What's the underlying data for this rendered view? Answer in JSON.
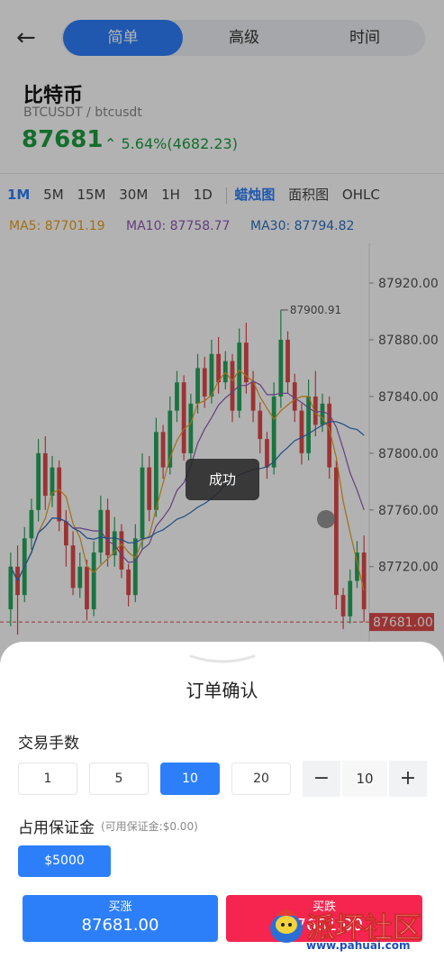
{
  "header": {
    "back_icon": "arrow-left-icon",
    "tabs": [
      {
        "label": "简单",
        "active": true
      },
      {
        "label": "高级",
        "active": false
      },
      {
        "label": "时间",
        "active": false
      }
    ]
  },
  "coin": {
    "name": "比特币",
    "pair": "BTCUSDT / btcusdt",
    "price": "87681",
    "change": "⌃ 5.64%(4682.23)"
  },
  "intervals": [
    "1M",
    "5M",
    "15M",
    "30M",
    "1H",
    "1D"
  ],
  "selected_interval": "1M",
  "chart_types": [
    "蜡烛图",
    "面积图",
    "OHLC"
  ],
  "selected_chart_type": "蜡烛图",
  "ma": {
    "ma5": "MA5: 87701.19",
    "ma10": "MA10: 87758.77",
    "ma30": "MA30: 87794.82",
    "colors": {
      "ma5": "#e8a020",
      "ma10": "#8e5bb5",
      "ma30": "#2f6fc0"
    }
  },
  "chart_data": {
    "type": "candlestick",
    "y_ticks": [
      "87920.00",
      "87880.00",
      "87840.00",
      "87800.00",
      "87760.00",
      "87720.00"
    ],
    "ylim": [
      87662,
      87948
    ],
    "high_label": "87900.91",
    "last_price_label": "87681.00",
    "colors": {
      "up": "#26a65b",
      "down": "#e04a4a"
    },
    "candles": [
      [
        87690,
        87720,
        87678,
        87730
      ],
      [
        87720,
        87700,
        87672,
        87735
      ],
      [
        87700,
        87740,
        87695,
        87748
      ],
      [
        87740,
        87760,
        87732,
        87768
      ],
      [
        87760,
        87800,
        87752,
        87810
      ],
      [
        87800,
        87770,
        87760,
        87812
      ],
      [
        87770,
        87790,
        87762,
        87798
      ],
      [
        87790,
        87752,
        87745,
        87795
      ],
      [
        87752,
        87735,
        87720,
        87760
      ],
      [
        87735,
        87705,
        87700,
        87745
      ],
      [
        87705,
        87720,
        87698,
        87730
      ],
      [
        87720,
        87690,
        87682,
        87725
      ],
      [
        87690,
        87730,
        87685,
        87738
      ],
      [
        87730,
        87760,
        87722,
        87770
      ],
      [
        87760,
        87728,
        87720,
        87768
      ],
      [
        87728,
        87745,
        87720,
        87755
      ],
      [
        87745,
        87718,
        87712,
        87750
      ],
      [
        87718,
        87700,
        87692,
        87722
      ],
      [
        87700,
        87740,
        87695,
        87750
      ],
      [
        87740,
        87790,
        87732,
        87800
      ],
      [
        87790,
        87760,
        87752,
        87798
      ],
      [
        87760,
        87815,
        87755,
        87825
      ],
      [
        87815,
        87790,
        87782,
        87820
      ],
      [
        87790,
        87830,
        87785,
        87840
      ],
      [
        87830,
        87850,
        87822,
        87858
      ],
      [
        87850,
        87800,
        87795,
        87855
      ],
      [
        87800,
        87835,
        87795,
        87842
      ],
      [
        87835,
        87860,
        87828,
        87870
      ],
      [
        87860,
        87840,
        87832,
        87868
      ],
      [
        87840,
        87870,
        87835,
        87880
      ],
      [
        87870,
        87850,
        87842,
        87882
      ],
      [
        87850,
        87865,
        87845,
        87872
      ],
      [
        87865,
        87830,
        87822,
        87870
      ],
      [
        87830,
        87878,
        87825,
        87888
      ],
      [
        87878,
        87850,
        87842,
        87892
      ],
      [
        87850,
        87830,
        87822,
        87858
      ],
      [
        87830,
        87810,
        87800,
        87836
      ],
      [
        87810,
        87790,
        87782,
        87815
      ],
      [
        87790,
        87840,
        87785,
        87850
      ],
      [
        87840,
        87880,
        87832,
        87901
      ],
      [
        87880,
        87850,
        87842,
        87886
      ],
      [
        87850,
        87830,
        87822,
        87856
      ],
      [
        87830,
        87800,
        87792,
        87835
      ],
      [
        87800,
        87840,
        87795,
        87852
      ],
      [
        87840,
        87820,
        87812,
        87858
      ],
      [
        87820,
        87835,
        87815,
        87842
      ],
      [
        87835,
        87790,
        87782,
        87840
      ],
      [
        87790,
        87700,
        87690,
        87795
      ],
      [
        87700,
        87685,
        87676,
        87705
      ],
      [
        87685,
        87710,
        87680,
        87718
      ],
      [
        87710,
        87730,
        87705,
        87738
      ],
      [
        87730,
        87690,
        87681,
        87742
      ]
    ]
  },
  "toast": "成功",
  "sheet": {
    "chevron_icon": "chevron-down-icon",
    "title": "订单确认",
    "lots_label": "交易手数",
    "lot_options": [
      "1",
      "5",
      "10",
      "20"
    ],
    "selected_lot": "10",
    "stepper_minus": "−",
    "stepper_value": "10",
    "stepper_plus": "+",
    "margin_label": "占用保证金",
    "available_label": "(可用保证金:$0.00)",
    "margin_option": "$5000",
    "buy_label": "买涨",
    "buy_price": "87681.00",
    "sell_label": "买跌",
    "sell_price": "87681.00"
  },
  "watermark": {
    "text": "派坏社区",
    "url": "www.pahuai.com"
  }
}
